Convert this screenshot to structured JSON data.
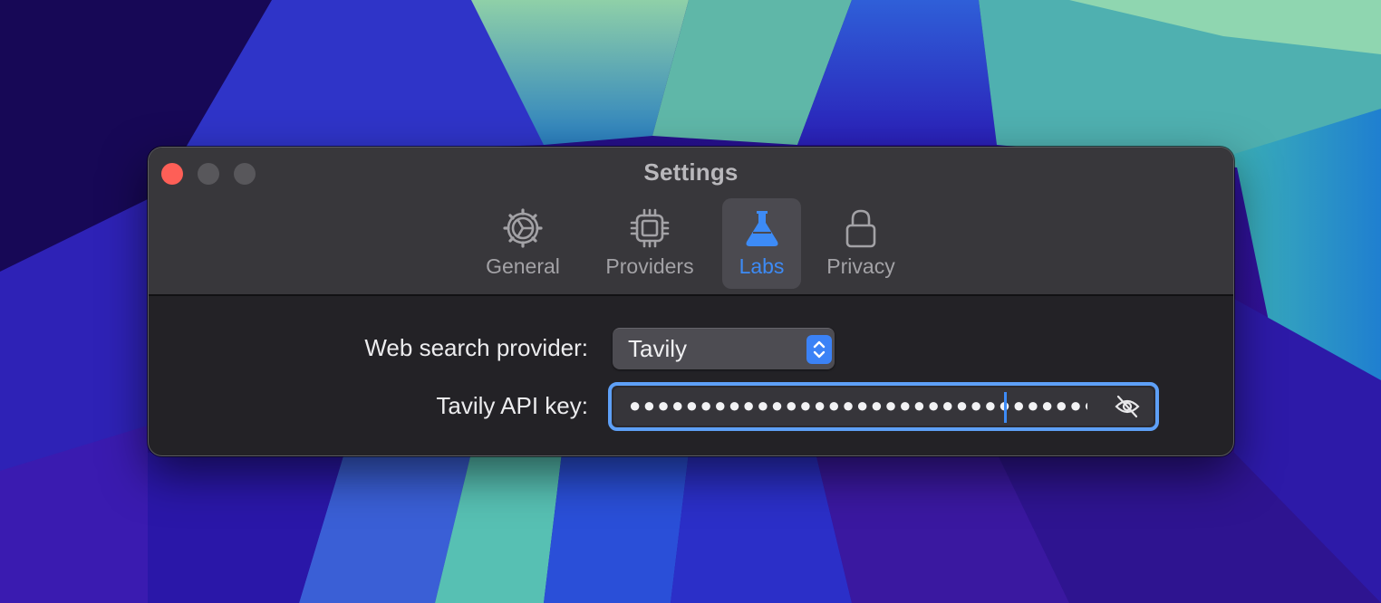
{
  "window": {
    "title": "Settings"
  },
  "tabs": [
    {
      "label": "General",
      "icon": "gear-icon",
      "selected": false
    },
    {
      "label": "Providers",
      "icon": "cpu-chip-icon",
      "selected": false
    },
    {
      "label": "Labs",
      "icon": "flask-icon",
      "selected": true
    },
    {
      "label": "Privacy",
      "icon": "lock-icon",
      "selected": false
    }
  ],
  "form": {
    "search_provider_label": "Web search provider:",
    "search_provider_value": "Tavily",
    "api_key_label": "Tavily API key:",
    "api_key_masked": "●●●●●●●●●●●●●●●●●●●●●●●●●●●●●●●●●●●●●●"
  },
  "colors": {
    "accent": "#3d8bf6",
    "close": "#fe5f57",
    "window_bg": "#232226",
    "toolbar_bg": "#38373b"
  }
}
